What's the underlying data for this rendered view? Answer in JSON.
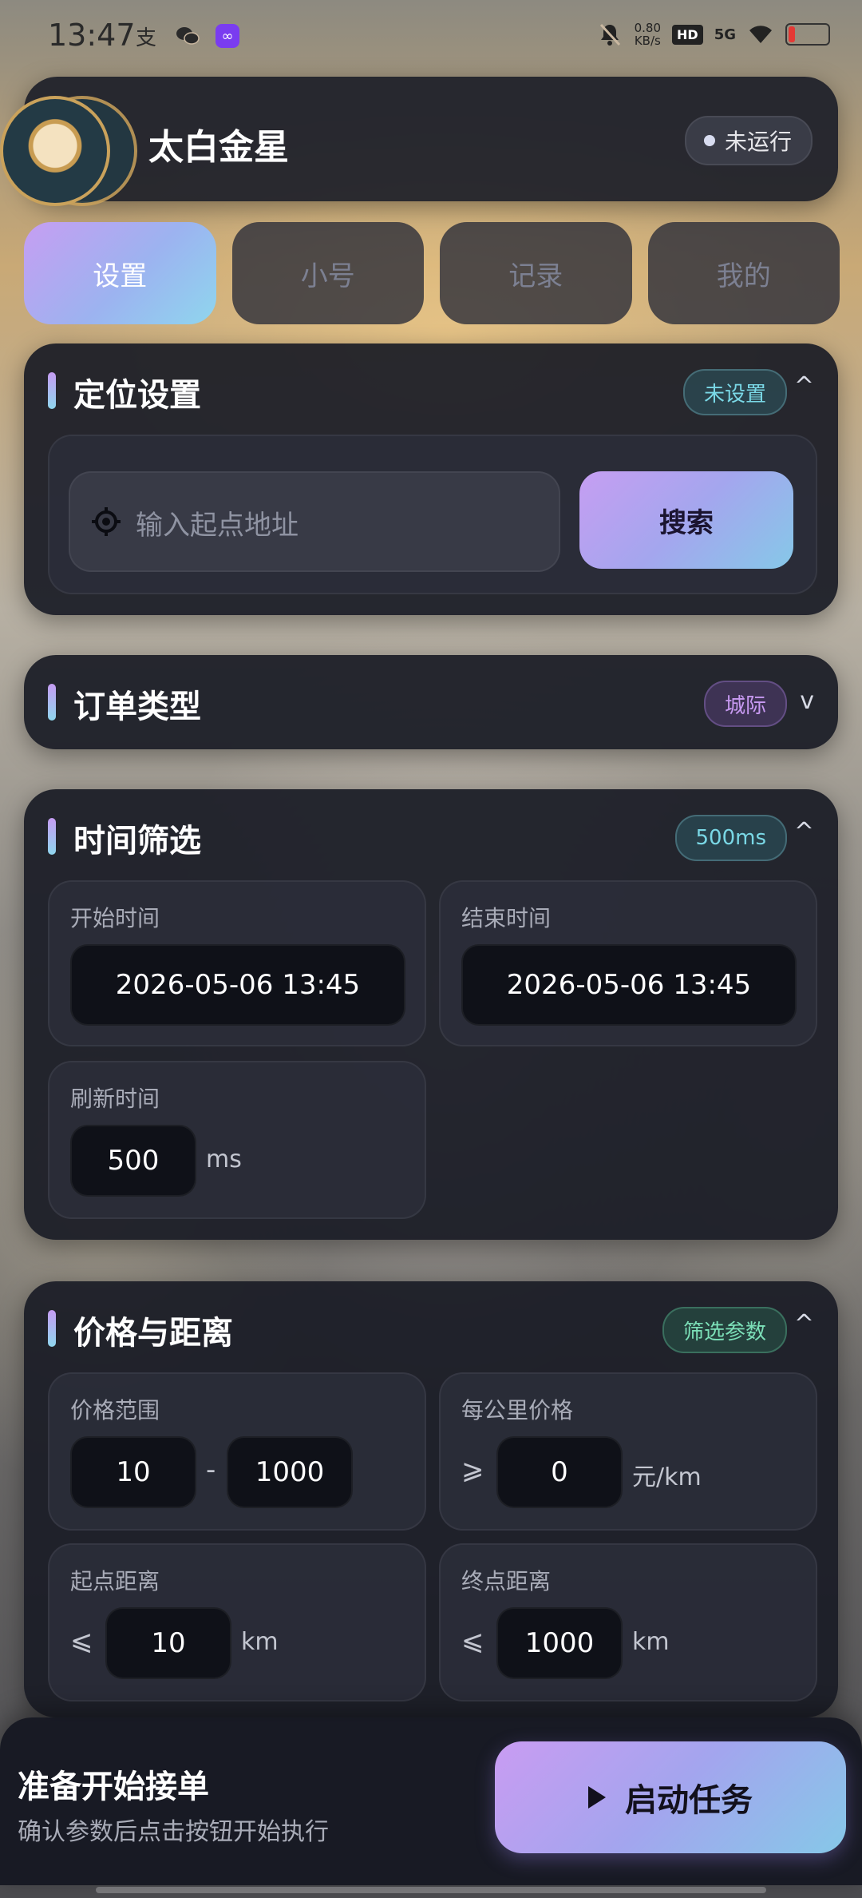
{
  "status_bar": {
    "time": "13:47",
    "left_icons": [
      "alipay-icon",
      "wechat-icon",
      "app-icon"
    ],
    "net_speed_value": "0.80",
    "net_speed_unit": "KB/s",
    "hd": "HD",
    "signal": "5G",
    "battery_color": "#e53935"
  },
  "header": {
    "title": "太白金星",
    "status": "未运行"
  },
  "tabs": [
    {
      "label": "设置",
      "active": true
    },
    {
      "label": "小号",
      "active": false
    },
    {
      "label": "记录",
      "active": false
    },
    {
      "label": "我的",
      "active": false
    }
  ],
  "location": {
    "title": "定位设置",
    "badge": "未设置",
    "chevron": "^",
    "placeholder": "输入起点地址",
    "search_label": "搜索"
  },
  "order_type": {
    "title": "订单类型",
    "badge": "城际",
    "chevron": "v"
  },
  "time_filter": {
    "title": "时间筛选",
    "badge": "500ms",
    "chevron": "^",
    "start_label": "开始时间",
    "start_value": "2026-05-06 13:45",
    "end_label": "结束时间",
    "end_value": "2026-05-06 13:45",
    "refresh_label": "刷新时间",
    "refresh_value": "500",
    "refresh_unit": "ms"
  },
  "price_distance": {
    "title": "价格与距离",
    "badge": "筛选参数",
    "chevron": "^",
    "price_range_label": "价格范围",
    "price_min": "10",
    "price_sep": "-",
    "price_max": "1000",
    "per_km_label": "每公里价格",
    "per_km_op": "⩾",
    "per_km_value": "0",
    "per_km_unit": "元/km",
    "start_dist_label": "起点距离",
    "start_dist_op": "⩽",
    "start_dist_value": "10",
    "start_dist_unit": "km",
    "end_dist_label": "终点距离",
    "end_dist_op": "⩽",
    "end_dist_value": "1000",
    "end_dist_unit": "km"
  },
  "bottom": {
    "title": "准备开始接单",
    "subtitle": "确认参数后点击按钮开始执行",
    "start_label": "启动任务"
  }
}
